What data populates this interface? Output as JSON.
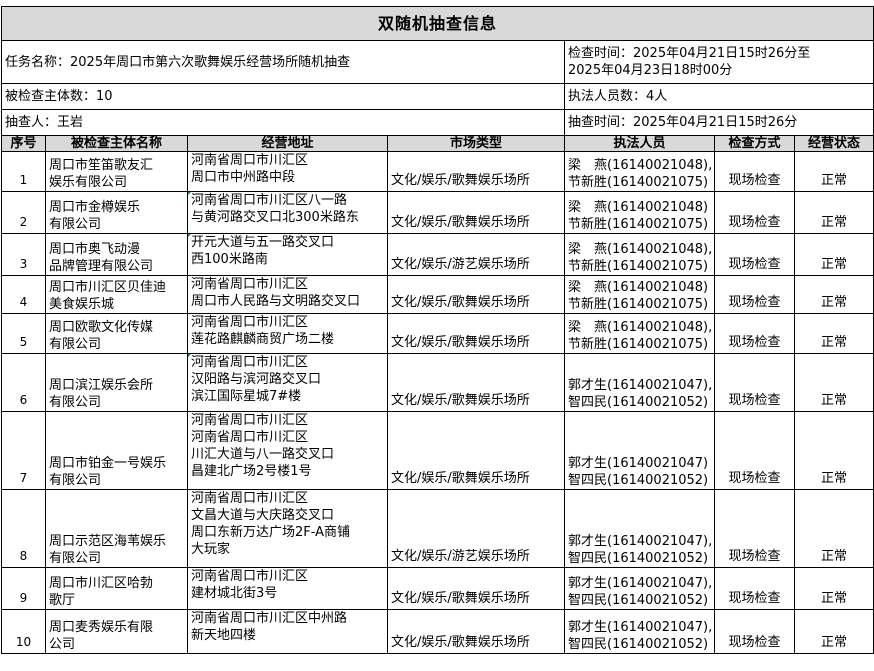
{
  "title": "双随机抽查信息",
  "task": {
    "name": "任务名称：2025年周口市第六次歌舞娱乐经营场所随机抽查",
    "inspection_period_line1": "检查时间：2025年04月21日15时26分至",
    "inspection_period_line2": "2025年04月23日18时00分",
    "subject_count": "被检查主体数：10",
    "officer_count": "执法人员数：4人",
    "sampler": "抽查人：王岩",
    "sampling_time": "抽查时间：2025年04月21日15时26分"
  },
  "columns": [
    "序号",
    "被检查主体名称",
    "经营地址",
    "市场类型",
    "执法人员",
    "检查方式",
    "经营状态"
  ],
  "rows": [
    {
      "no": "1",
      "name": [
        "周口市笙笛歌友汇",
        "娱乐有限公司"
      ],
      "address": [
        "河南省周口市川汇区",
        "周口市中州路中段"
      ],
      "type": "文化/娱乐/歌舞娱乐场所",
      "officers": [
        "梁　燕(16140021048),",
        "节新胜(16140021075)"
      ],
      "method": "现场检查",
      "status": "正常"
    },
    {
      "no": "2",
      "name": [
        "周口市金樽娱乐",
        "有限公司"
      ],
      "address": [
        "河南省周口市川汇区八一路",
        "与黄河路交叉口北300米路东"
      ],
      "type": "文化/娱乐/歌舞娱乐场所",
      "officers": [
        "梁　燕(16140021048)",
        "节新胜(16140021075)"
      ],
      "method": "现场检查",
      "status": "正常"
    },
    {
      "no": "3",
      "name": [
        "周口市奥飞动漫",
        "品牌管理有限公司"
      ],
      "address": [
        "开元大道与五一路交叉口",
        "西100米路南"
      ],
      "type": "文化/娱乐/游艺娱乐场所",
      "officers": [
        "梁　燕(16140021048),",
        "节新胜(16140021075)"
      ],
      "method": "现场检查",
      "status": "正常"
    },
    {
      "no": "4",
      "name": [
        "周口市川汇区贝佳迪",
        "美食娱乐城"
      ],
      "address": [
        "河南省周口市川汇区",
        "周口市人民路与文明路交叉口"
      ],
      "type": "文化/娱乐/歌舞娱乐场所",
      "officers": [
        "梁　燕(16140021048)",
        "节新胜(16140021075)"
      ],
      "method": "现场检查",
      "status": "正常"
    },
    {
      "no": "5",
      "name": [
        "周口欧歌文化传媒",
        "有限公司"
      ],
      "address": [
        "河南省周口市川汇区",
        "莲花路麒麟商贸广场二楼"
      ],
      "type": "文化/娱乐/歌舞娱乐场所",
      "officers": [
        "梁　燕(16140021048),",
        "节新胜(16140021075)"
      ],
      "method": "现场检查",
      "status": "正常"
    },
    {
      "no": "6",
      "name": [
        "周口滨江娱乐会所",
        "有限公司"
      ],
      "address": [
        "河南省周口市川汇区",
        "汉阳路与滨河路交叉口",
        "滨江国际星城7#楼"
      ],
      "type": "文化/娱乐/歌舞娱乐场所",
      "officers": [
        "郭才生(16140021047),",
        "智四民(16140021052)"
      ],
      "method": "现场检查",
      "status": "正常"
    },
    {
      "no": "7",
      "name": [
        "周口市铂金一号娱乐",
        "有限公司"
      ],
      "address": [
        "河南省周口市川汇区",
        "河南省周口市川汇区",
        "川汇大道与八一路交叉口",
        "昌建北广场2号楼1号"
      ],
      "type": "文化/娱乐/歌舞娱乐场所",
      "officers": [
        "郭才生(16140021047)",
        "智四民(16140021052)"
      ],
      "method": "现场检查",
      "status": "正常"
    },
    {
      "no": "8",
      "name": [
        "周口示范区海苇娱乐",
        "有限公司"
      ],
      "address": [
        "河南省周口市川汇区",
        "文昌大道与大庆路交叉口",
        "周口东新万达广场2F-A商铺",
        "大玩家"
      ],
      "type": "文化/娱乐/游艺娱乐场所",
      "officers": [
        "郭才生(16140021047),",
        "智四民(16140021052)"
      ],
      "method": "现场检查",
      "status": "正常"
    },
    {
      "no": "9",
      "name": [
        "周口市川汇区哈勃",
        "歌厅"
      ],
      "address": [
        "河南省周口市川汇区",
        "建材城北街3号"
      ],
      "type": "文化/娱乐/歌舞娱乐场所",
      "officers": [
        "郭才生(16140021047),",
        "智四民(16140021052)"
      ],
      "method": "现场检查",
      "status": "正常"
    },
    {
      "no": "10",
      "name": [
        "周口麦秀娱乐有限",
        "公司"
      ],
      "address": [
        "河南省周口市川汇区中州路",
        "新天地四楼"
      ],
      "type": "文化/娱乐/歌舞娱乐场所",
      "officers": [
        "郭才生(16140021047),",
        "智四民(16140021052)"
      ],
      "method": "现场检查",
      "status": "正常"
    }
  ]
}
